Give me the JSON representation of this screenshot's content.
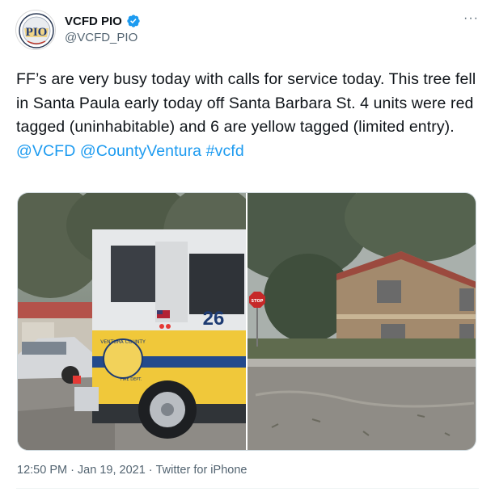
{
  "author": {
    "display_name": "VCFD PIO",
    "handle": "@VCFD_PIO",
    "avatar_text": "PIO",
    "verified_icon": "verified-badge-icon",
    "verified_color": "#1d9bf0"
  },
  "more_label": "···",
  "tweet": {
    "text_part1": "FF’s are very busy today with calls for service today. This tree fell in Santa Paula early today off Santa Barbara St. 4 units were red tagged (uninhabitable) and 6 are yellow tagged (limited entry). ",
    "mention1": "@VCFD",
    "mention2": "@CountyVentura",
    "hashtag": "#vcfd",
    "link_color": "#1d9bf0"
  },
  "media": {
    "photo1": {
      "truck_number": "26",
      "door_text": "VENTURA COUNTY",
      "door_subtext": "FIRE DEPT."
    },
    "photo2": {
      "sign_text": "STOP"
    }
  },
  "footer": {
    "time": "12:50 PM",
    "date": "Jan 19, 2021",
    "separator": "·",
    "source": "Twitter for iPhone"
  }
}
